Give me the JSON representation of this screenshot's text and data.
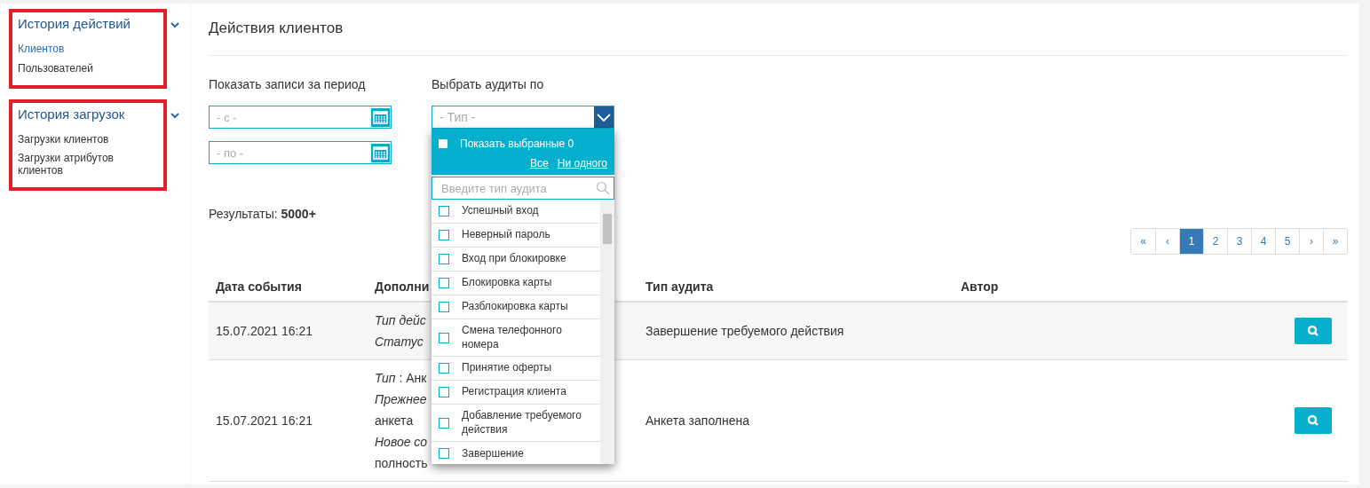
{
  "sidebar": {
    "sections": [
      {
        "title": "История действий",
        "expanded": true,
        "items": [
          {
            "label": "Клиентов",
            "selected": true
          },
          {
            "label": "Пользователей",
            "selected": false
          }
        ]
      },
      {
        "title": "История загрузок",
        "expanded": true,
        "items": [
          {
            "label": "Загрузки клиентов",
            "selected": false
          },
          {
            "label": "Загрузки атрибутов клиентов",
            "selected": false
          }
        ]
      }
    ]
  },
  "page_title": "Действия клиентов",
  "period": {
    "label": "Показать записи за период",
    "from_placeholder": "- с -",
    "to_placeholder": "- по -"
  },
  "audit_filter": {
    "label": "Выбрать аудиты по",
    "placeholder": "- Тип -",
    "expanded": true,
    "dropdown": {
      "show_selected": {
        "label": "Показать выбранные 0",
        "checked": false
      },
      "all_link": "Все",
      "none_link": "Ни одного",
      "search_placeholder": "Введите тип аудита",
      "options": [
        {
          "label": "Успешный вход",
          "checked": false
        },
        {
          "label": "Неверный пароль",
          "checked": false
        },
        {
          "label": "Вход при блокировке",
          "checked": false
        },
        {
          "label": "Блокировка карты",
          "checked": false
        },
        {
          "label": "Разблокировка карты",
          "checked": false
        },
        {
          "label": "Смена телефонного номера",
          "checked": false
        },
        {
          "label": "Принятие оферты",
          "checked": false
        },
        {
          "label": "Регистрация клиента",
          "checked": false
        },
        {
          "label": "Добавление требуемого действия",
          "checked": false
        },
        {
          "label": "Завершение",
          "checked": false
        }
      ]
    }
  },
  "results": {
    "label": "Результаты:",
    "count": "5000+"
  },
  "pagination": [
    {
      "label": "«",
      "selected": false
    },
    {
      "label": "‹",
      "selected": false
    },
    {
      "label": "1",
      "selected": true
    },
    {
      "label": "2",
      "selected": false
    },
    {
      "label": "3",
      "selected": false
    },
    {
      "label": "4",
      "selected": false
    },
    {
      "label": "5",
      "selected": false
    },
    {
      "label": "›",
      "selected": false
    },
    {
      "label": "»",
      "selected": false
    }
  ],
  "table": {
    "columns": [
      "Дата события",
      "Дополни",
      "Тип аудита",
      "Автор"
    ],
    "rows": [
      {
        "date": "15.07.2021 16:21",
        "details": [
          "*Тип дейс*",
          "*Статус*"
        ],
        "audit_type": "Завершение требуемого действия"
      },
      {
        "date": "15.07.2021 16:21",
        "details": [
          "*Тип* : Анк",
          "*Прежнее*",
          "анкета",
          "*Новое со*",
          "полность"
        ],
        "audit_type": "Анкета заполнена"
      }
    ]
  }
}
